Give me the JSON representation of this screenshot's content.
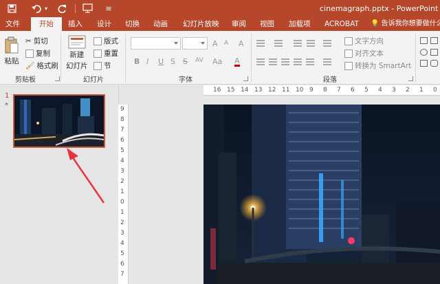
{
  "titlebar": {
    "title": "cinemagraph.pptx - PowerPoint",
    "qa_icons": [
      "save-icon",
      "undo-icon",
      "undo-dropdown-icon",
      "redo-icon",
      "start-from-beginning-icon"
    ]
  },
  "tabs": [
    {
      "label": "文件"
    },
    {
      "label": "开始",
      "active": true
    },
    {
      "label": "插入"
    },
    {
      "label": "设计"
    },
    {
      "label": "切换"
    },
    {
      "label": "动画"
    },
    {
      "label": "幻灯片放映"
    },
    {
      "label": "审阅"
    },
    {
      "label": "视图"
    },
    {
      "label": "加载项"
    },
    {
      "label": "ACROBAT"
    }
  ],
  "tell_me": "告诉我你想要做什么",
  "ribbon": {
    "clipboard": {
      "paste": "粘贴",
      "cut": "剪切",
      "copy": "复制",
      "format_painter": "格式刷",
      "label": "剪贴板"
    },
    "slides": {
      "new_slide_1": "新建",
      "new_slide_2": "幻灯片",
      "layout": "版式",
      "reset": "重置",
      "section": "节",
      "label": "幻灯片"
    },
    "font": {
      "font_name": "",
      "font_size": "",
      "label": "字体",
      "bold": "B",
      "italic": "I",
      "underline": "U",
      "strike": "S",
      "spacing": "AV",
      "case": "Aa",
      "color": "A",
      "grow": "A",
      "shrink": "A",
      "clear": "A"
    },
    "paragraph": {
      "text_direction": "文字方向",
      "align_text": "对齐文本",
      "smartart": "转换为 SmartArt",
      "label": "段落"
    }
  },
  "slide_pane": {
    "number": "1",
    "star": "*"
  },
  "hruler": {
    "ticks": [
      "16",
      "15",
      "14",
      "13",
      "12",
      "11",
      "10",
      "9",
      "8",
      "7",
      "6",
      "5",
      "4",
      "3",
      "2",
      "1",
      "0"
    ]
  },
  "vruler": {
    "ticks": [
      "9",
      "8",
      "7",
      "6",
      "5",
      "4",
      "3",
      "2",
      "1",
      "0",
      "1",
      "2",
      "3",
      "4",
      "5",
      "6",
      "7"
    ]
  },
  "colors": {
    "accent": "#b7472a",
    "ribbon": "#f3f3f3"
  }
}
